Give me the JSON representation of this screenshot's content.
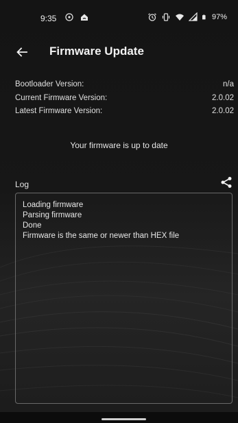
{
  "status_bar": {
    "time": "9:35",
    "left_icons": [
      "shield-circle-icon",
      "home-wifi-icon"
    ],
    "right_icons": [
      "alarm-icon",
      "vibrate-icon",
      "wifi-icon",
      "signal-icon",
      "battery-icon"
    ],
    "battery": "97%"
  },
  "app_bar": {
    "title": "Firmware Update",
    "back_icon": "arrow-left-icon"
  },
  "versions": [
    {
      "label": "Bootloader Version:",
      "value": "n/a"
    },
    {
      "label": "Current Firmware Version:",
      "value": "2.0.02"
    },
    {
      "label": "Latest Firmware Version:",
      "value": "2.0.02"
    }
  ],
  "status_message": "Your firmware is up to date",
  "log": {
    "label": "Log",
    "share_icon": "share-icon",
    "lines": [
      "Loading firmware",
      "Parsing firmware",
      "Done",
      "Firmware is the same or newer than HEX file"
    ]
  },
  "colors": {
    "background": "#141414",
    "text": "#e6e6e6",
    "border": "#6a6a6a"
  }
}
